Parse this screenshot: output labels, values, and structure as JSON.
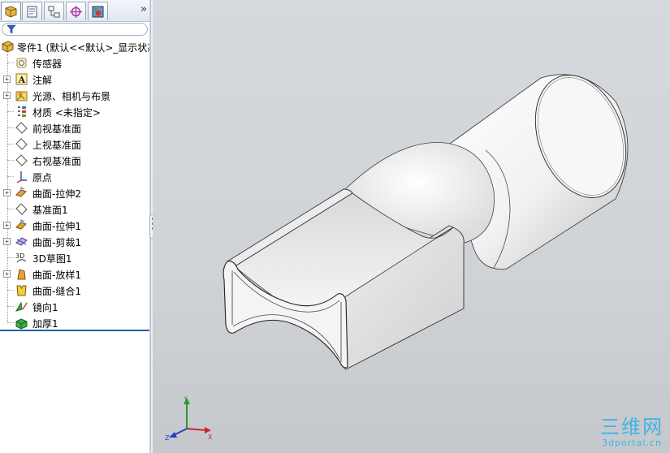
{
  "tabs": [
    {
      "icon": "feature-manager-icon"
    },
    {
      "icon": "property-manager-icon"
    },
    {
      "icon": "configuration-manager-icon"
    },
    {
      "icon": "dim-xpert-icon"
    },
    {
      "icon": "display-manager-icon"
    }
  ],
  "tabs_more": "»",
  "tree": {
    "root": {
      "label": "零件1  (默认<<默认>_显示状态"
    },
    "items": [
      {
        "label": "传感器",
        "icon": "sensor-icon",
        "expandable": false
      },
      {
        "label": "注解",
        "icon": "annotation-icon",
        "expandable": true
      },
      {
        "label": "光源、相机与布景",
        "icon": "lights-cameras-scene-icon",
        "expandable": true
      },
      {
        "label": "材质 <未指定>",
        "icon": "material-icon",
        "expandable": false
      },
      {
        "label": "前视基准面",
        "icon": "plane-icon",
        "expandable": false
      },
      {
        "label": "上视基准面",
        "icon": "plane-icon",
        "expandable": false
      },
      {
        "label": "右视基准面",
        "icon": "plane-icon",
        "expandable": false
      },
      {
        "label": "原点",
        "icon": "origin-icon",
        "expandable": false
      },
      {
        "label": "曲面-拉伸2",
        "icon": "surface-extrude-icon",
        "expandable": true
      },
      {
        "label": "基准面1",
        "icon": "plane-icon",
        "expandable": false
      },
      {
        "label": "曲面-拉伸1",
        "icon": "surface-extrude-icon",
        "expandable": true
      },
      {
        "label": "曲面-剪裁1",
        "icon": "surface-trim-icon",
        "expandable": true
      },
      {
        "label": "3D草图1",
        "icon": "sketch-3d-icon",
        "expandable": false
      },
      {
        "label": "曲面-放样1",
        "icon": "surface-loft-icon",
        "expandable": true
      },
      {
        "label": "曲面-缝合1",
        "icon": "surface-knit-icon",
        "expandable": false
      },
      {
        "label": "镜向1",
        "icon": "mirror-icon",
        "expandable": false
      },
      {
        "label": "加厚1",
        "icon": "thicken-icon",
        "expandable": false
      }
    ]
  },
  "triad": {
    "x_label": "X",
    "y_label": "Y",
    "z_label": "Z"
  },
  "watermark": {
    "main": "三维网",
    "sub": "3dportal.cn"
  },
  "colors": {
    "accent": "#1f5fb3",
    "viewport_bg": "#d3d6da",
    "model": "#f2f2f2",
    "watermark": "#3fb5e6"
  }
}
